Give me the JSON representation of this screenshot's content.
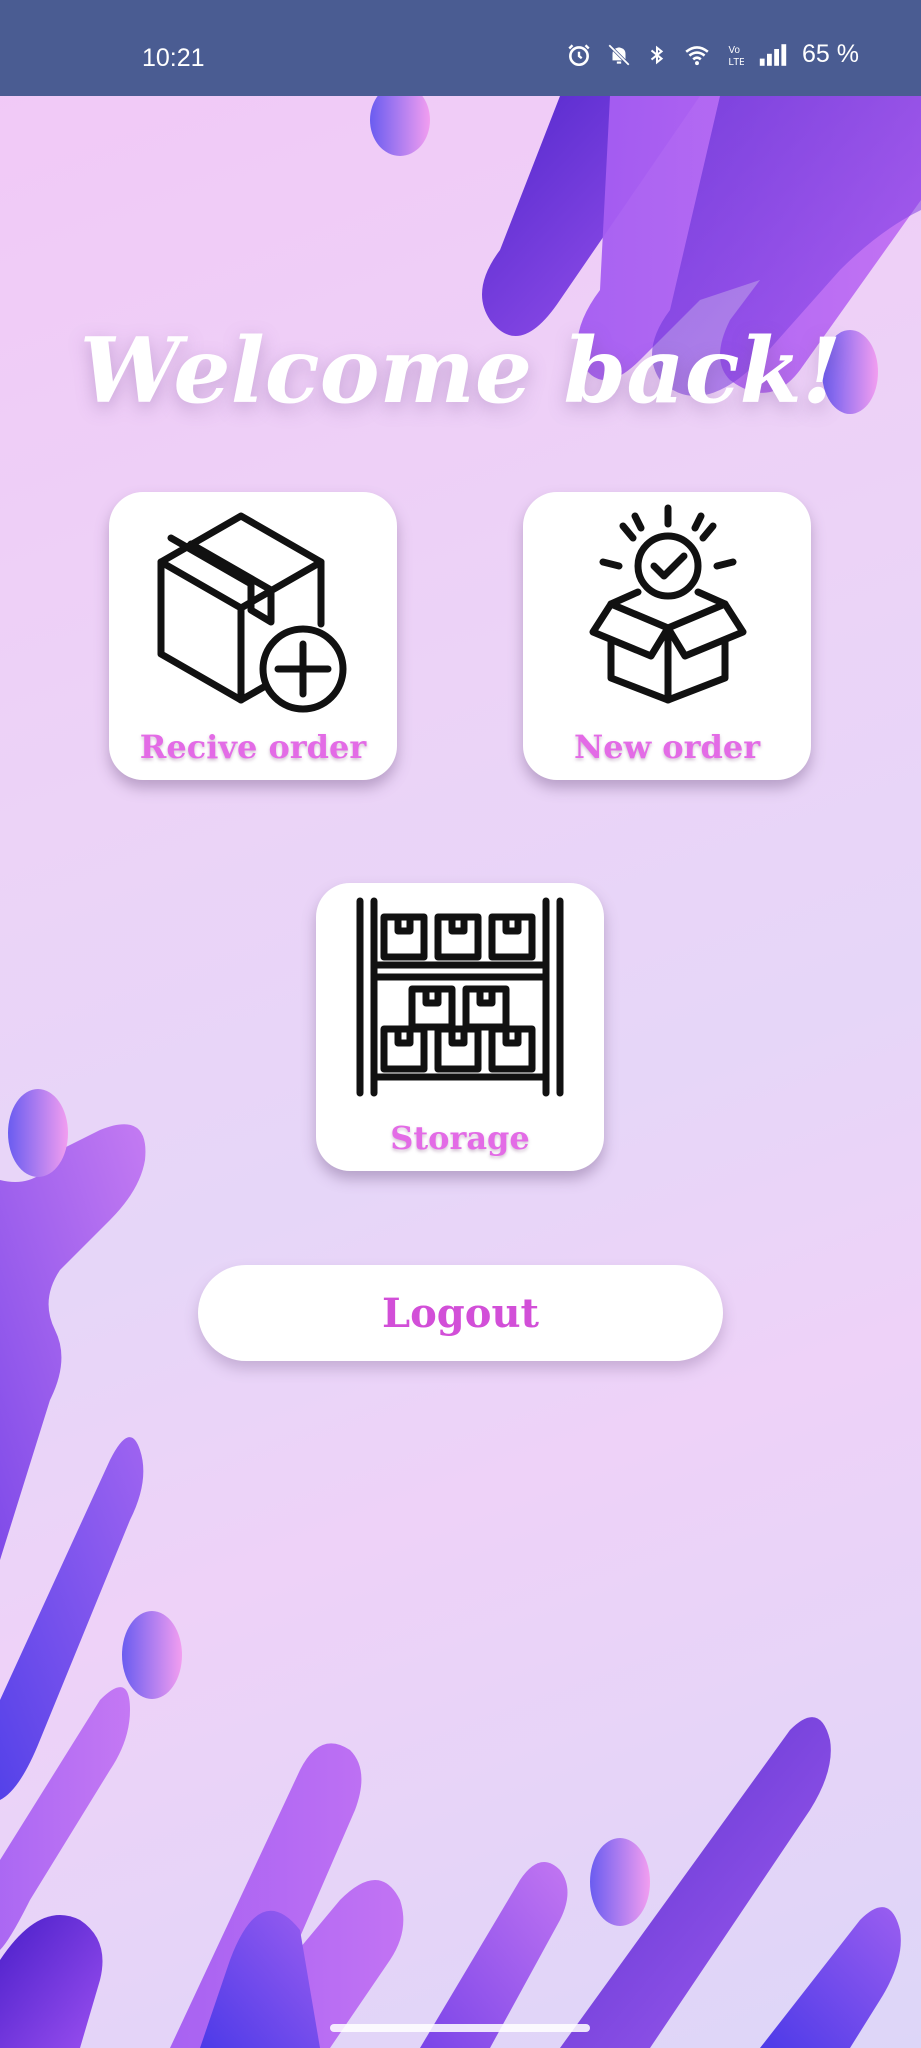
{
  "status_bar": {
    "time": "10:21",
    "battery": "65 %",
    "icons": [
      "alarm-icon",
      "mute-icon",
      "bluetooth-icon",
      "wifi-icon",
      "volte-icon",
      "signal-icon"
    ]
  },
  "main": {
    "title": "Welcome back!",
    "cards": [
      {
        "label": "Recive order",
        "icon": "box-add-icon"
      },
      {
        "label": "New order",
        "icon": "open-box-check-icon"
      },
      {
        "label": "Storage",
        "icon": "shelf-boxes-icon"
      }
    ],
    "logout_label": "Logout"
  },
  "colors": {
    "status_bar": "#4a5c92",
    "label": "#e36be6",
    "logout_text": "#d24fd8",
    "blob_dark": "#5b3de0",
    "blob_light": "#b46bf5"
  }
}
